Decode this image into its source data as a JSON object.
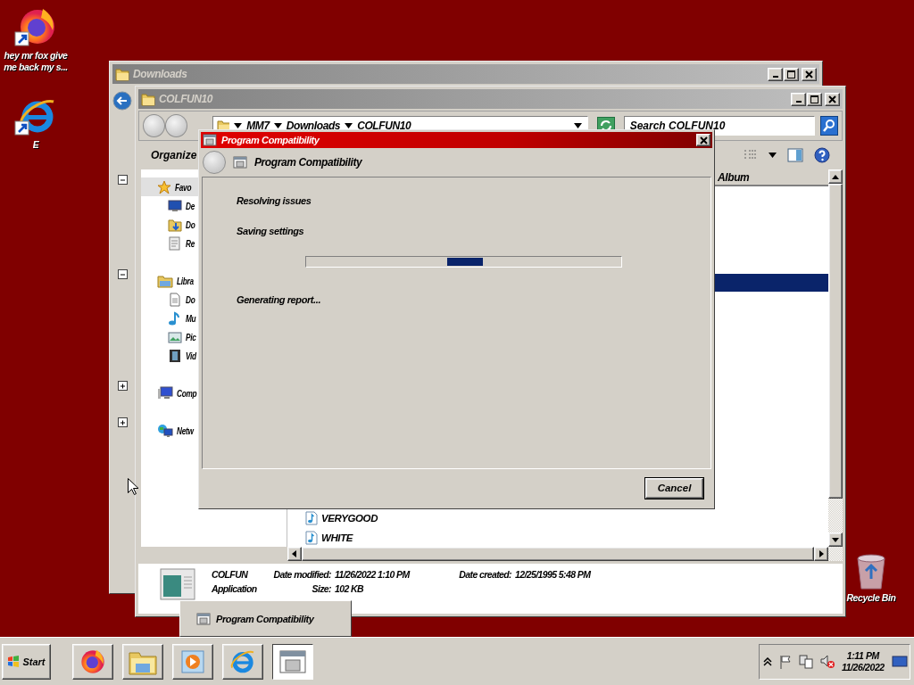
{
  "desktop_icons": [
    {
      "label": "hey mr fox give me back my s...",
      "kind": "firefox"
    },
    {
      "label": "E",
      "kind": "ie"
    },
    {
      "label": "Recycle Bin",
      "kind": "recycle"
    }
  ],
  "back_window": {
    "title": "Downloads",
    "tree_toggles": [
      {
        "expanded": true
      },
      {
        "expanded": true
      },
      {
        "expanded": false
      },
      {
        "expanded": false
      }
    ]
  },
  "explorer": {
    "title": "COLFUN10",
    "address": [
      "MM7",
      "Downloads",
      "COLFUN10"
    ],
    "search": {
      "placeholder": "Search COLFUN10"
    },
    "organize": "Organize",
    "nav_pane": [
      {
        "label": "Favo",
        "kind": "favorites",
        "selected": true,
        "children": [
          {
            "label": "De",
            "kind": "desktop",
            "selected": false
          },
          {
            "label": "Do",
            "kind": "downloads",
            "selected": false
          },
          {
            "label": "Re",
            "kind": "recent",
            "selected": false
          }
        ]
      },
      {
        "label": "Libra",
        "kind": "libraries",
        "selected": false,
        "children": [
          {
            "label": "Do",
            "kind": "documents",
            "selected": false
          },
          {
            "label": "Mu",
            "kind": "music",
            "selected": false
          },
          {
            "label": "Pic",
            "kind": "pictures",
            "selected": false
          },
          {
            "label": "Vid",
            "kind": "videos",
            "selected": false
          }
        ]
      },
      {
        "label": "Comp",
        "kind": "computer",
        "selected": false
      },
      {
        "label": "Netw",
        "kind": "network",
        "selected": false
      }
    ],
    "columns": [
      "Album"
    ],
    "rows": [
      {
        "selected": true
      },
      {
        "name": "VERYGOOD",
        "selected": false
      },
      {
        "name": "WHITE",
        "selected": false
      }
    ],
    "details": {
      "name": "COLFUN",
      "type": "Application",
      "fields": [
        {
          "label": "Date modified:",
          "value": "11/26/2022 1:10 PM"
        },
        {
          "label": "Date created:",
          "value": "12/25/1995 5:48 PM"
        },
        {
          "label": "Size:",
          "value": "102 KB"
        }
      ]
    }
  },
  "dialog": {
    "title": "Program Compatibility",
    "heading": "Program Compatibility",
    "steps": [
      "Resolving issues",
      "Saving settings",
      "Generating report..."
    ],
    "button": "Cancel"
  },
  "taskbar_preview": {
    "label": "Program Compatibility"
  },
  "taskbar": {
    "start": "Start",
    "apps": [
      {
        "kind": "firefox",
        "selected": false
      },
      {
        "kind": "explorer",
        "selected": false
      },
      {
        "kind": "media",
        "selected": false
      },
      {
        "kind": "ie",
        "selected": false
      },
      {
        "kind": "compat",
        "selected": true
      }
    ],
    "clock": {
      "time": "1:11 PM",
      "date": "11/26/2022"
    }
  }
}
